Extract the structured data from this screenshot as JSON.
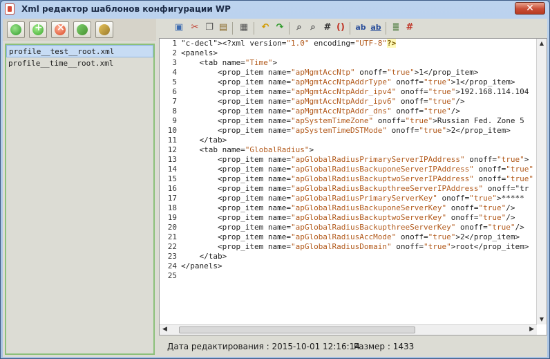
{
  "window": {
    "title": "Xml редактор шаблонов конфигурации WP",
    "close_label": "✕"
  },
  "left_toolbar": {
    "buttons": [
      {
        "name": "refresh",
        "icon": "refresh-icon"
      },
      {
        "name": "add",
        "icon": "add-icon"
      },
      {
        "name": "delete",
        "icon": "delete-icon"
      },
      {
        "name": "rename",
        "icon": "rename-icon"
      },
      {
        "name": "pack",
        "icon": "pack-icon"
      }
    ]
  },
  "files": [
    {
      "name": "profile__test__root.xml",
      "selected": true
    },
    {
      "name": "profile__time__root.xml",
      "selected": false
    }
  ],
  "editor_toolbar": {
    "icons": [
      "save-icon",
      "cut-icon",
      "copy-icon",
      "paste-icon",
      "document-icon",
      "undo-icon",
      "redo-icon",
      "find-icon",
      "find-replace-icon",
      "hash-icon",
      "brackets-icon",
      "text-style-icon",
      "text-underline-icon",
      "lines-icon",
      "hash-red-icon"
    ],
    "hash_label": "#",
    "brackets_label": "()",
    "ab_label": "ab",
    "ab2_label": "ab"
  },
  "editor": {
    "line_numbers": [
      "1",
      "2",
      "3",
      "4",
      "5",
      "6",
      "7",
      "8",
      "9",
      "10",
      "11",
      "12",
      "13",
      "14",
      "15",
      "16",
      "17",
      "18",
      "19",
      "20",
      "21",
      "22",
      "23",
      "24",
      "25"
    ],
    "lines": [
      "<?xml version=\"1.0\" encoding=\"UTF-8\"?>",
      "<panels>",
      "    <tab name=\"Time\">",
      "        <prop_item name=\"apMgmtAccNtp\" onoff=\"true\">1</prop_item>",
      "        <prop_item name=\"apMgmtAccNtpAddrType\" onoff=\"true\">1</prop_item>",
      "        <prop_item name=\"apMgmtAccNtpAddr_ipv4\" onoff=\"true\">192.168.114.104",
      "        <prop_item name=\"apMgmtAccNtpAddr_ipv6\" onoff=\"true\"/>",
      "        <prop_item name=\"apMgmtAccNtpAddr_dns\" onoff=\"true\"/>",
      "        <prop_item name=\"apSystemTimeZone\" onoff=\"true\">Russian Fed. Zone 5",
      "        <prop_item name=\"apSystemTimeDSTMode\" onoff=\"true\">2</prop_item>",
      "    </tab>",
      "    <tab name=\"GlobalRadius\">",
      "        <prop_item name=\"apGlobalRadiusPrimaryServerIPAddress\" onoff=\"true\">",
      "        <prop_item name=\"apGlobalRadiusBackuponeServerIPAddress\" onoff=\"true\"",
      "        <prop_item name=\"apGlobalRadiusBackuptwoServerIPAddress\" onoff=\"true\"",
      "        <prop_item name=\"apGlobalRadiusBackupthreeServerIPAddress\" onoff=\"tr",
      "        <prop_item name=\"apGlobalRadiusPrimaryServerKey\" onoff=\"true\">*****",
      "        <prop_item name=\"apGlobalRadiusBackuponeServerKey\" onoff=\"true\"/>",
      "        <prop_item name=\"apGlobalRadiusBackuptwoServerKey\" onoff=\"true\"/>",
      "        <prop_item name=\"apGlobalRadiusBackupthreeServerKey\" onoff=\"true\"/>",
      "        <prop_item name=\"apGlobalRadiusAccMode\" onoff=\"true\">2</prop_item>",
      "        <prop_item name=\"apGlobalRadiusDomain\" onoff=\"true\">root</prop_item>",
      "    </tab>",
      "</panels>",
      ""
    ]
  },
  "status": {
    "edited_label": "Дата редактирования : 2015-10-01 12:16:14",
    "size_label": "Размер : 1433"
  }
}
